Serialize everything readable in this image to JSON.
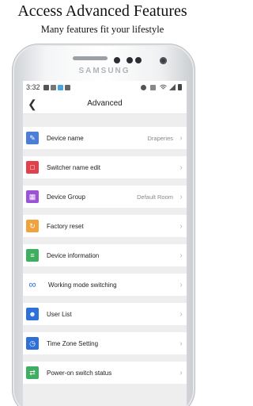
{
  "promo": {
    "headline": "Access Advanced Features",
    "subline": "Many features fit your lifestyle"
  },
  "device": {
    "brand": "SAMSUNG"
  },
  "status_bar": {
    "time": "3:32"
  },
  "header": {
    "back_icon": "chevron-left",
    "title": "Advanced"
  },
  "menu": [
    {
      "label": "Device name",
      "value": "Draperies",
      "icon": "pin-icon",
      "color": "#4a7ed8"
    },
    {
      "label": "Switcher name edit",
      "value": "",
      "icon": "bookmark-icon",
      "color": "#e0424c"
    },
    {
      "label": "Device Group",
      "value": "Default Room",
      "icon": "group-icon",
      "color": "#9b52d6"
    },
    {
      "label": "Factory reset",
      "value": "",
      "icon": "reset-icon",
      "color": "#f0a33c"
    },
    {
      "label": "Device information",
      "value": "",
      "icon": "info-icon",
      "color": "#3fae60"
    },
    {
      "label": "Working mode switching",
      "value": "",
      "icon": "infinity-icon",
      "color": "#2f6fd8"
    },
    {
      "label": "User List",
      "value": "",
      "icon": "user-icon",
      "color": "#2f6fd8"
    },
    {
      "label": "Time Zone Setting",
      "value": "",
      "icon": "clock-icon",
      "color": "#2f6fd8"
    },
    {
      "label": "Power-on switch status",
      "value": "",
      "icon": "switch-icon",
      "color": "#3fae60"
    }
  ]
}
